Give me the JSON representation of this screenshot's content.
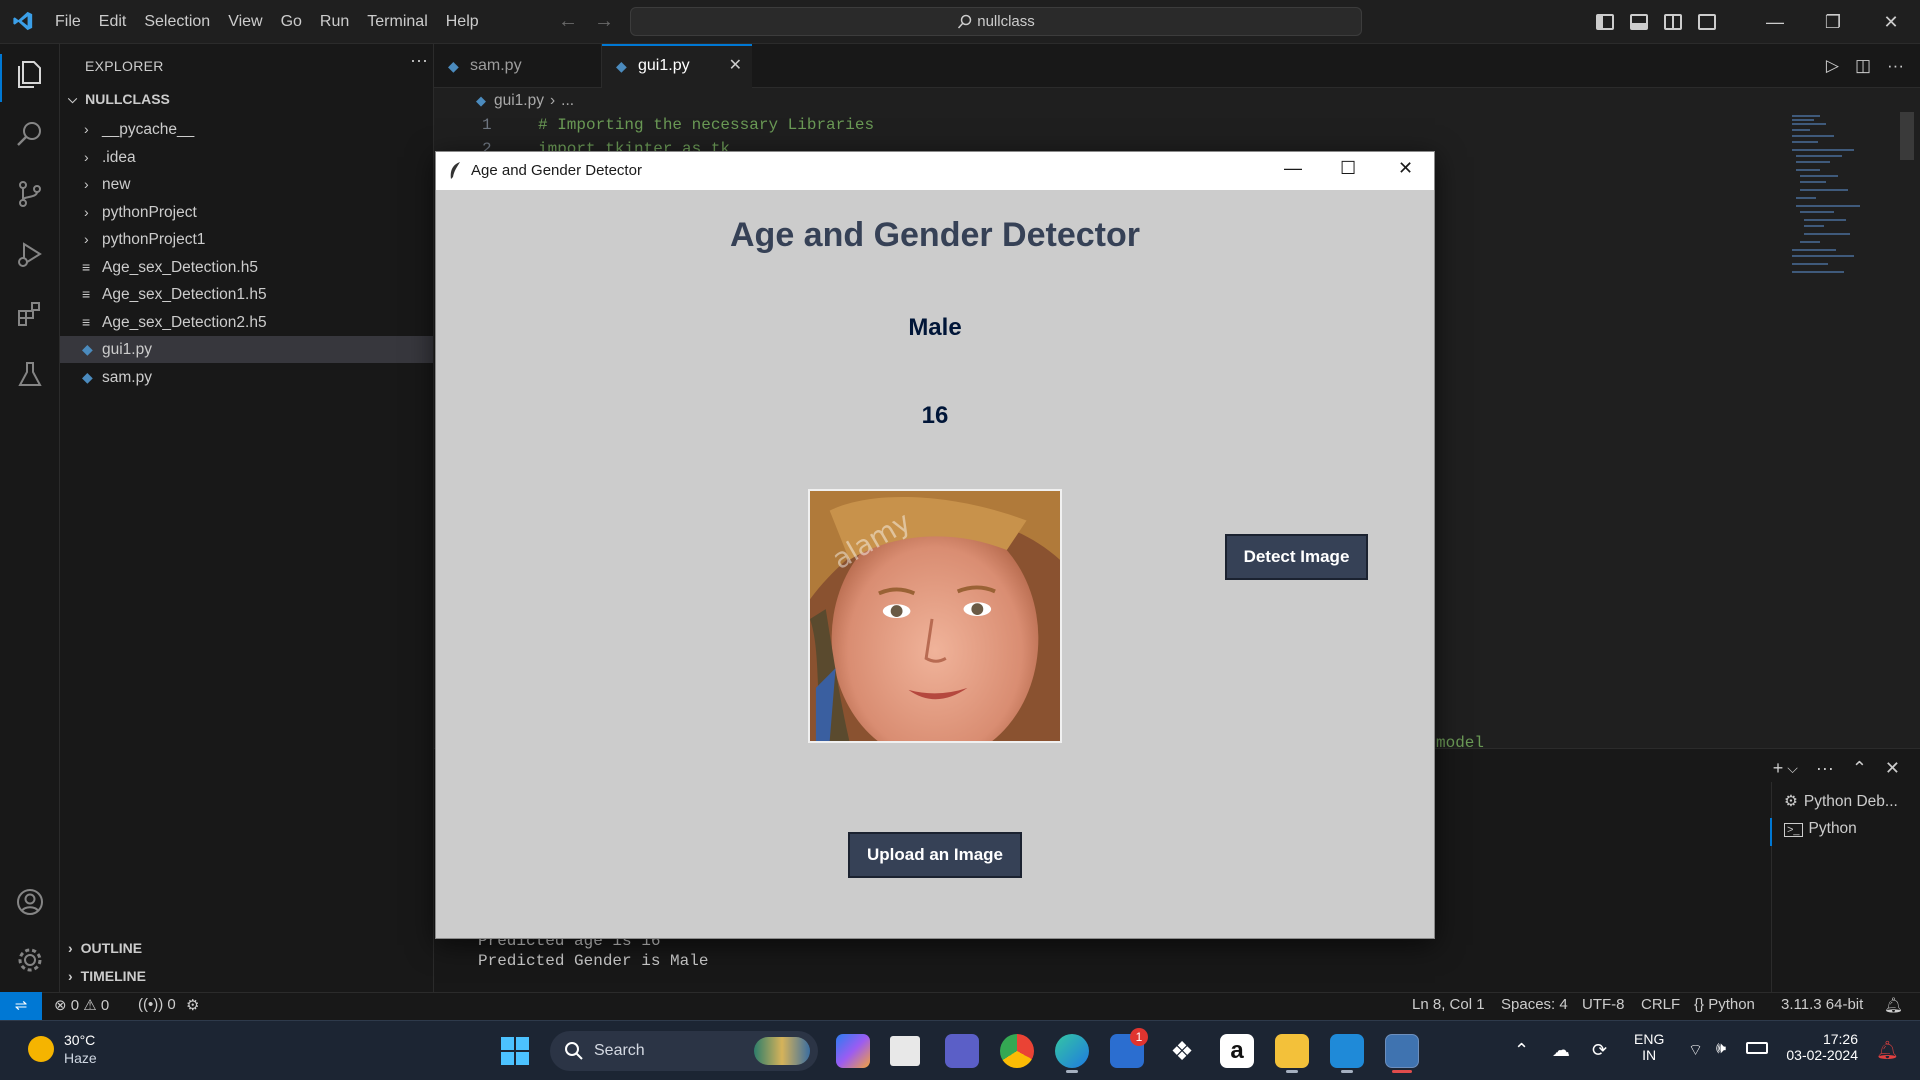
{
  "menu": [
    "File",
    "Edit",
    "Selection",
    "View",
    "Go",
    "Run",
    "Terminal",
    "Help"
  ],
  "command_center": "nullclass",
  "sidebar": {
    "title": "EXPLORER",
    "root": "NULLCLASS",
    "items": [
      {
        "label": "__pycache__",
        "kind": "folder"
      },
      {
        "label": ".idea",
        "kind": "folder"
      },
      {
        "label": "new",
        "kind": "folder"
      },
      {
        "label": "pythonProject",
        "kind": "folder"
      },
      {
        "label": "pythonProject1",
        "kind": "folder"
      },
      {
        "label": "Age_sex_Detection.h5",
        "kind": "file"
      },
      {
        "label": "Age_sex_Detection1.h5",
        "kind": "file"
      },
      {
        "label": "Age_sex_Detection2.h5",
        "kind": "file"
      },
      {
        "label": "gui1.py",
        "kind": "python",
        "selected": true
      },
      {
        "label": "sam.py",
        "kind": "python"
      }
    ],
    "outline": "OUTLINE",
    "timeline": "TIMELINE"
  },
  "tabs": [
    {
      "label": "sam.py",
      "active": false
    },
    {
      "label": "gui1.py",
      "active": true
    }
  ],
  "breadcrumb": {
    "file": "gui1.py",
    "rest": "..."
  },
  "code": [
    {
      "num": "1",
      "text": "# Importing the necessary Libraries"
    },
    {
      "num": "2",
      "text": "import tkinter as tk"
    }
  ],
  "code_fragment": "model",
  "panel": {
    "terminals": [
      "Python Deb...",
      "Python"
    ],
    "output": [
      "Predicted age is 16",
      "Predicted Gender is Male"
    ]
  },
  "statusbar": {
    "errors": "0",
    "warnings": "0",
    "ports": "0",
    "position": "Ln 8, Col 1",
    "spaces": "Spaces: 4",
    "encoding": "UTF-8",
    "eol": "CRLF",
    "language": "Python",
    "interpreter": "3.11.3 64-bit"
  },
  "tk_window": {
    "title": "Age and Gender Detector",
    "heading": "Age and Gender Detector",
    "gender": "Male",
    "age": "16",
    "detect_button": "Detect Image",
    "upload_button": "Upload an Image"
  },
  "taskbar": {
    "weather_temp": "30°C",
    "weather_desc": "Haze",
    "search_label": "Search",
    "store_badge": "1",
    "lang": "ENG",
    "region": "IN",
    "time": "17:26",
    "date": "03-02-2024"
  },
  "colors": {
    "accent": "#0078d4",
    "tk_bg": "#cccccc",
    "tk_heading": "#364156",
    "tk_button": "#364156",
    "tk_label": "#011638"
  }
}
